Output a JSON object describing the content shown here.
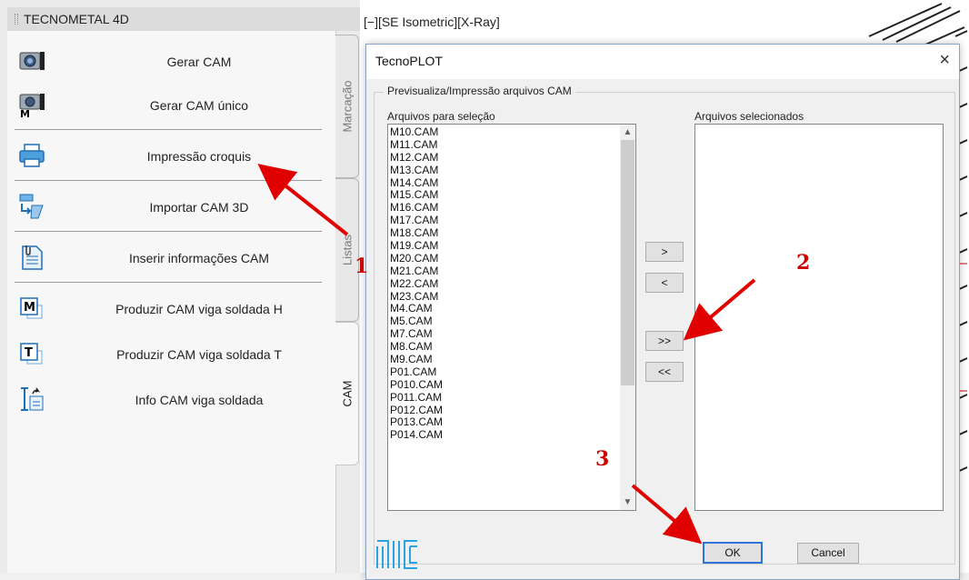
{
  "palette": {
    "title": "TECNOMETAL 4D",
    "items": [
      {
        "label": "Gerar CAM",
        "icon": "camera-icon"
      },
      {
        "label": "Gerar CAM único",
        "icon": "camera-m-icon"
      },
      {
        "label": "Impressão croquis",
        "icon": "printer-icon"
      },
      {
        "label": "Importar CAM 3D",
        "icon": "import-3d-icon"
      },
      {
        "label": "Inserir informações CAM",
        "icon": "paperclip-document-icon"
      },
      {
        "label": "Produzir CAM viga soldada H",
        "icon": "m-box-icon"
      },
      {
        "label": "Produzir CAM viga soldada T",
        "icon": "t-box-icon"
      },
      {
        "label": "Info CAM viga soldada",
        "icon": "beam-info-icon"
      }
    ],
    "tabs": [
      "Marcação",
      "Listas",
      "CAM"
    ]
  },
  "viewport": {
    "label": "[−][SE Isometric][X-Ray]"
  },
  "dialog": {
    "title": "TecnoPLOT",
    "close_glyph": "×",
    "group_title": "Previsualiza/Impressão arquivos CAM",
    "available_label": "Arquivos para seleção",
    "selected_label": "Arquivos selecionados",
    "available_files": [
      "M10.CAM",
      "M11.CAM",
      "M12.CAM",
      "M13.CAM",
      "M14.CAM",
      "M15.CAM",
      "M16.CAM",
      "M17.CAM",
      "M18.CAM",
      "M19.CAM",
      "M20.CAM",
      "M21.CAM",
      "M22.CAM",
      "M23.CAM",
      "M4.CAM",
      "M5.CAM",
      "M7.CAM",
      "M8.CAM",
      "M9.CAM",
      "P01.CAM",
      "P010.CAM",
      "P011.CAM",
      "P012.CAM",
      "P013.CAM",
      "P014.CAM"
    ],
    "selected_files": [],
    "buttons": {
      "add": ">",
      "remove": "<",
      "add_all": ">>",
      "remove_all": "<<",
      "ok": "OK",
      "cancel": "Cancel"
    }
  },
  "annotations": {
    "numbers": [
      "1",
      "2",
      "3"
    ],
    "color": "#cc0000"
  },
  "colors": {
    "accent": "#2f73d8",
    "annotation": "#cc0000"
  }
}
